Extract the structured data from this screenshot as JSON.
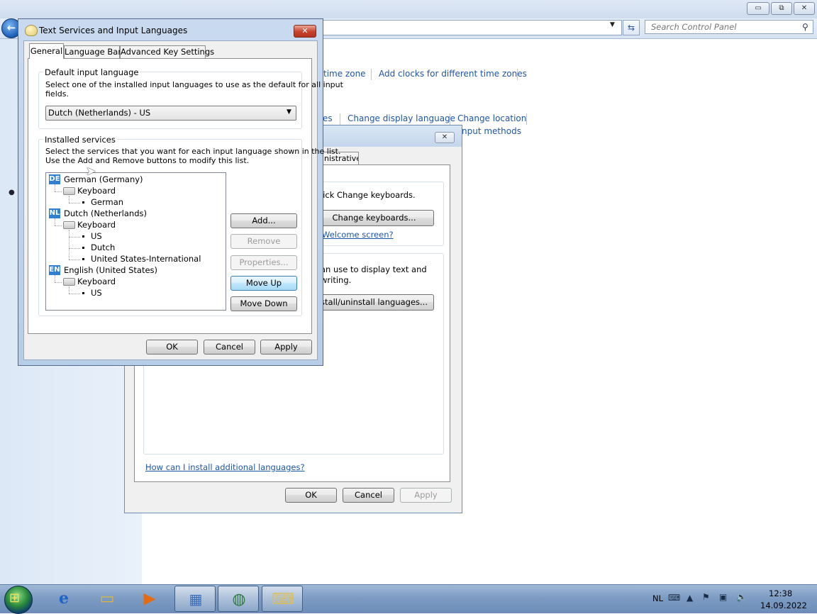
{
  "control_panel": {
    "search_placeholder": "Search Control Panel",
    "window_buttons": {
      "minimize": "▭",
      "maximize": "⧉",
      "close": "✕"
    },
    "links_row1": [
      "time zone",
      "Add clocks for different time zones"
    ],
    "links_row2": [
      "es",
      "Change display language",
      "Change location"
    ],
    "links_row3": "nput methods"
  },
  "region_dialog": {
    "close_glyph": "✕",
    "admin_tab": "ninistrative",
    "keyboards_text": "lick Change keyboards.",
    "change_keyboards": "Change keyboards...",
    "welcome_link": "Welcome screen?",
    "display_text_1": "an use to display text and",
    "display_text_2": "writing.",
    "install_button": "stall/uninstall languages...",
    "help_link": "How can I install additional languages?",
    "ok": "OK",
    "cancel": "Cancel",
    "apply": "Apply"
  },
  "text_services": {
    "title": "Text Services and Input Languages",
    "close_glyph": "✕",
    "tabs": [
      "General",
      "Language Bar",
      "Advanced Key Settings"
    ],
    "default_group": {
      "label": "Default input language",
      "desc_line1": "Select one of the installed input languages to use as the default for all input",
      "desc_line2": "fields.",
      "selected": "Dutch (Netherlands) - US"
    },
    "services_group": {
      "label": "Installed services",
      "desc_line1": "Select the services that you want for each input language shown in the list.",
      "desc_line2": "Use the Add and Remove buttons to modify this list."
    },
    "tree": {
      "de": {
        "badge": "DE",
        "name": "German (Germany)",
        "category": "Keyboard",
        "layouts": [
          "German"
        ]
      },
      "nl": {
        "badge": "NL",
        "name": "Dutch (Netherlands)",
        "category": "Keyboard",
        "layouts": [
          "US",
          "Dutch",
          "United States-International"
        ]
      },
      "en": {
        "badge": "EN",
        "name": "English (United States)",
        "category": "Keyboard",
        "layouts": [
          "US"
        ]
      }
    },
    "buttons": {
      "add": "Add...",
      "remove": "Remove",
      "properties": "Properties...",
      "move_up": "Move Up",
      "move_down": "Move Down",
      "ok": "OK",
      "cancel": "Cancel",
      "apply": "Apply"
    }
  },
  "taskbar": {
    "language": "NL",
    "time": "12:38",
    "date": "14.09.2022"
  }
}
